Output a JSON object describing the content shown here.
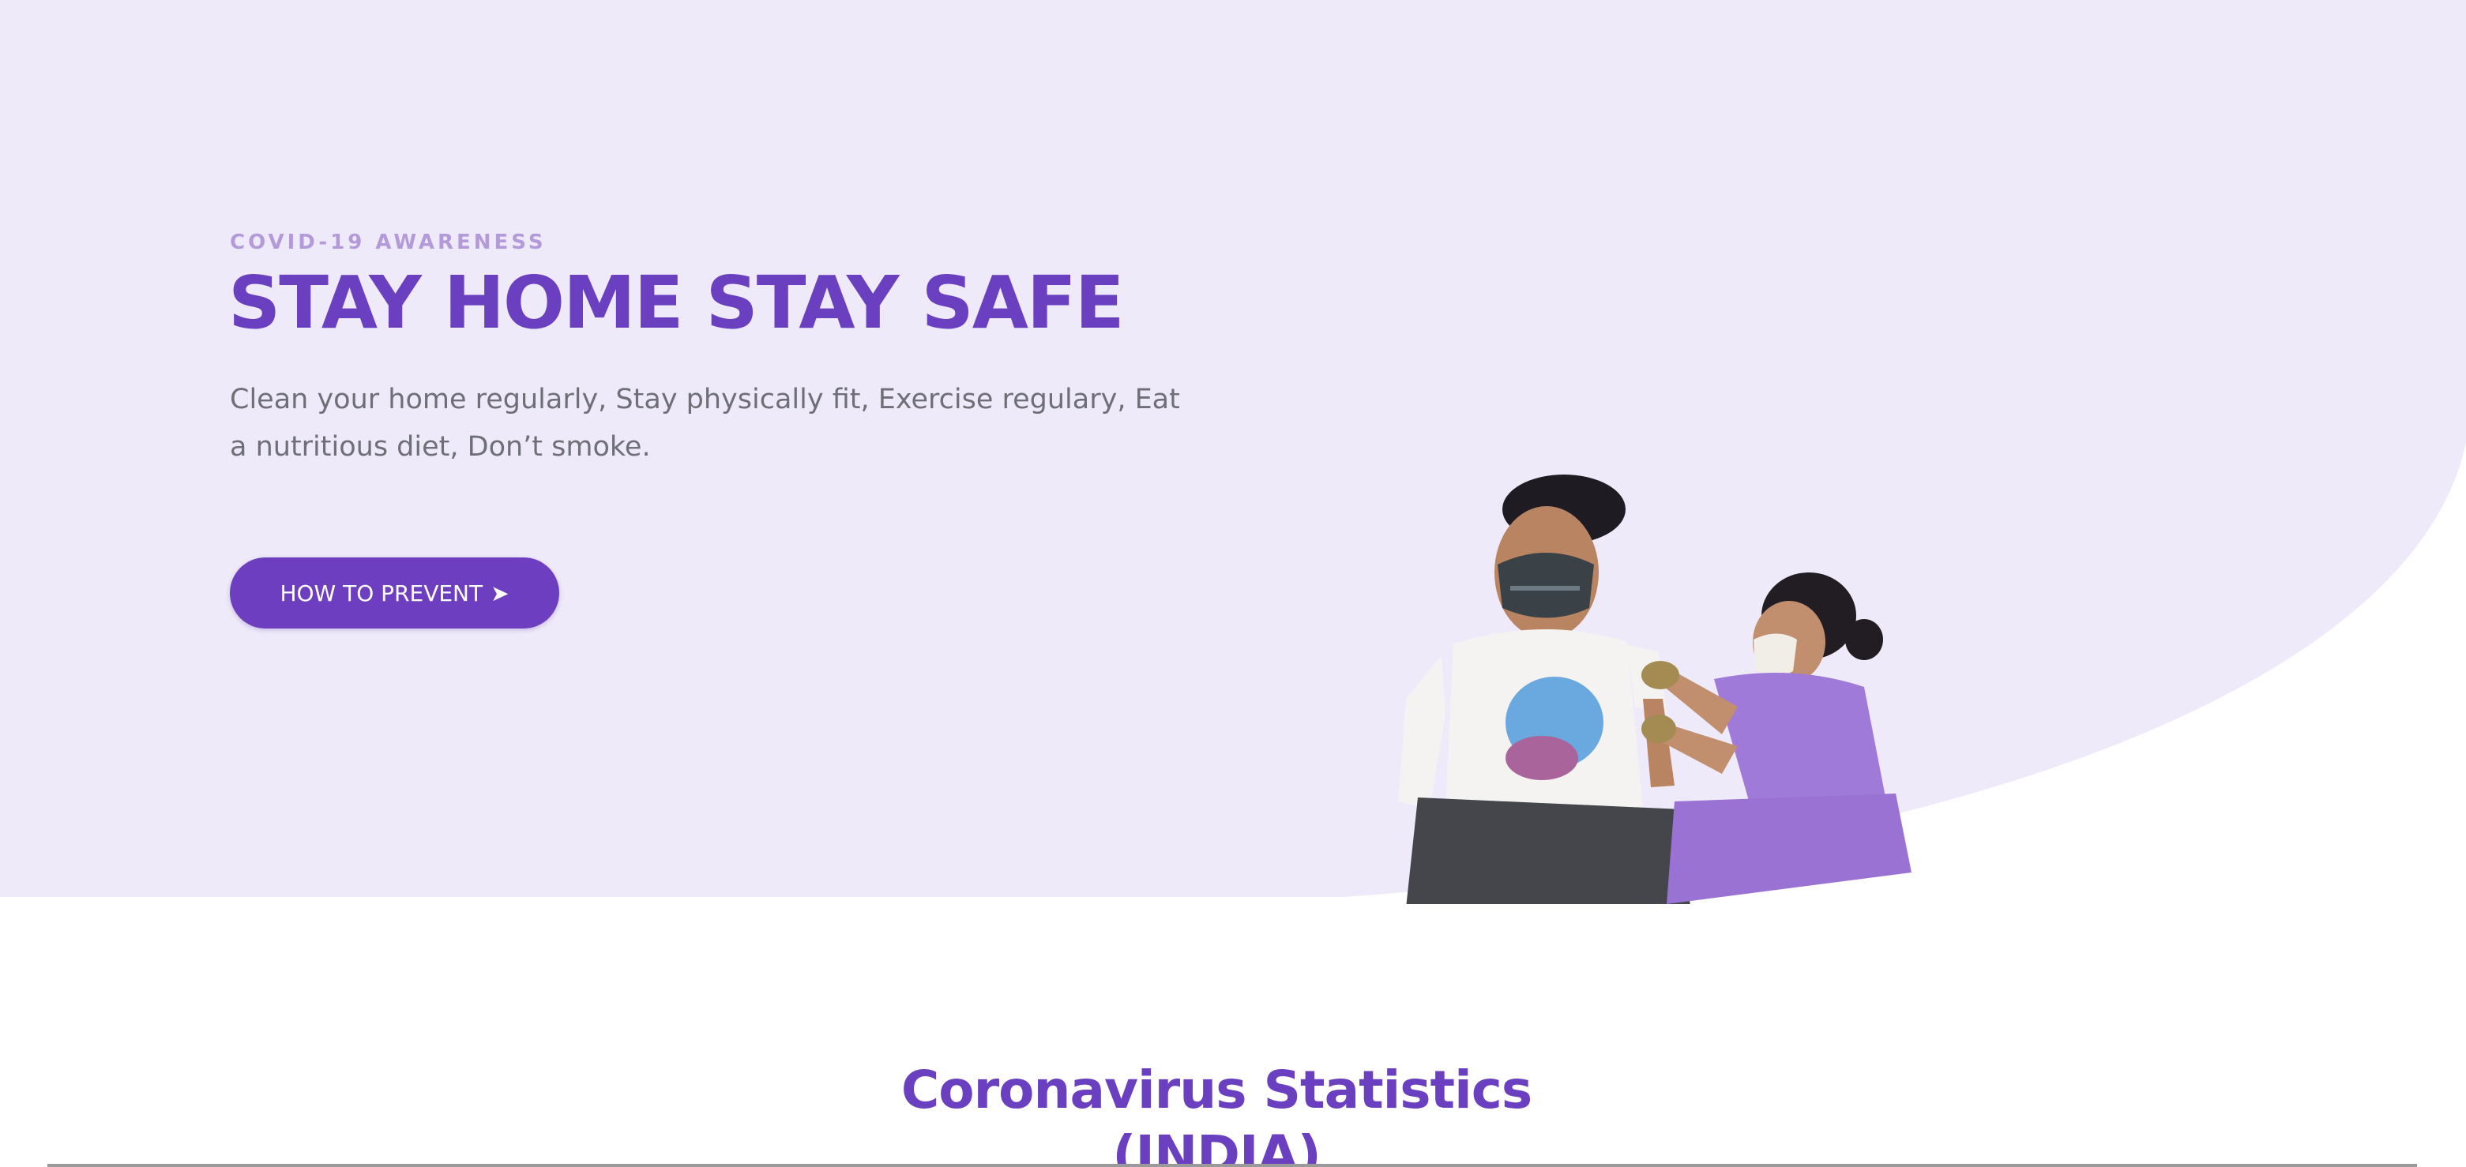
{
  "hero": {
    "eyebrow": "COVID-19 AWARENESS",
    "title": "STAY HOME STAY SAFE",
    "text": "Clean your home regularly, Stay physically fit, Exercise regulary, Eat a nutritious diet, Don’t smoke.",
    "button_label": "HOW TO PREVENT",
    "button_icon": "arrow-right-icon"
  },
  "stats": {
    "title_line1": "Coronavirus Statistics",
    "title_line2": "(INDIA)"
  },
  "colors": {
    "hero_background": "#efeafa",
    "accent": "#6a3fc0",
    "eyebrow": "#b39ad9",
    "body_text": "#6f6f77"
  }
}
